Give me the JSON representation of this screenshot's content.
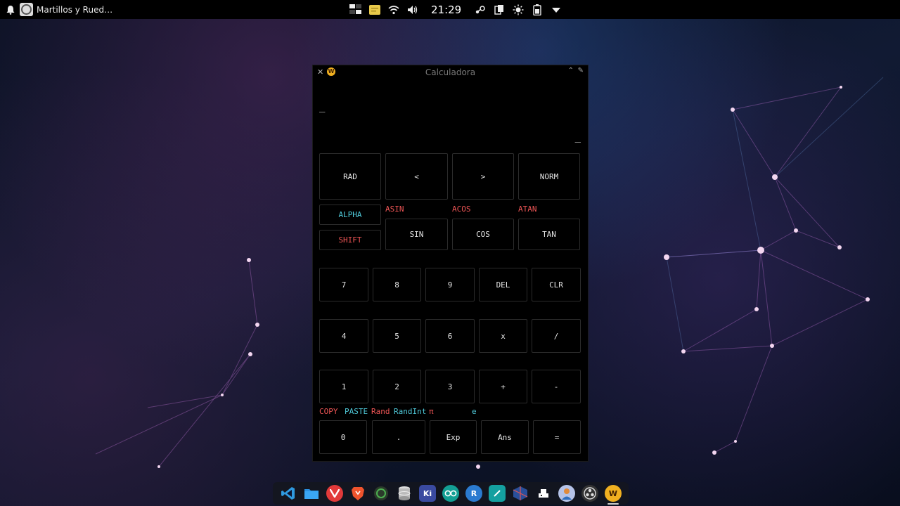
{
  "topbar": {
    "task_title": "Martillos y Rued…",
    "clock": "21:29",
    "tray_icons": [
      "network-icon",
      "notes-icon",
      "wifi-icon",
      "volume-icon",
      "steam-icon",
      "clipboard-icon",
      "brightness-icon",
      "battery-icon",
      "menu-arrow-icon"
    ]
  },
  "window": {
    "title": "Calculadora",
    "display": {
      "input": "_",
      "result": "_"
    },
    "row1": [
      "RAD",
      "<",
      ">",
      "NORM"
    ],
    "inverse_labels": [
      "ASIN",
      "ACOS",
      "ATAN"
    ],
    "alpha": "ALPHA",
    "shift": "SHIFT",
    "trig": [
      "SIN",
      "COS",
      "TAN"
    ],
    "row_789": [
      "7",
      "8",
      "9",
      "DEL",
      "CLR"
    ],
    "row_456": [
      "4",
      "5",
      "6",
      "x",
      "/"
    ],
    "row_123": [
      "1",
      "2",
      "3",
      "+",
      "-"
    ],
    "secondary": {
      "copy": "COPY",
      "paste": "PASTE",
      "rand": "Rand",
      "randint": "RandInt",
      "pi": "π",
      "e": "e"
    },
    "row_0": [
      "0",
      ".",
      "Exp",
      "Ans",
      "="
    ]
  },
  "dock": {
    "items": [
      "vscode-icon",
      "files-icon",
      "vivaldi-icon",
      "brave-icon",
      "arduino-icon",
      "database-icon",
      "kicad-icon",
      "arduino-ide-icon",
      "r-icon",
      "terminal-icon",
      "virtualbox-icon",
      "keyboard-icon",
      "user-icon",
      "obs-icon",
      "calculator-icon"
    ],
    "labels": {
      "kicad": "Ki",
      "r": "R",
      "calc": "W"
    }
  }
}
